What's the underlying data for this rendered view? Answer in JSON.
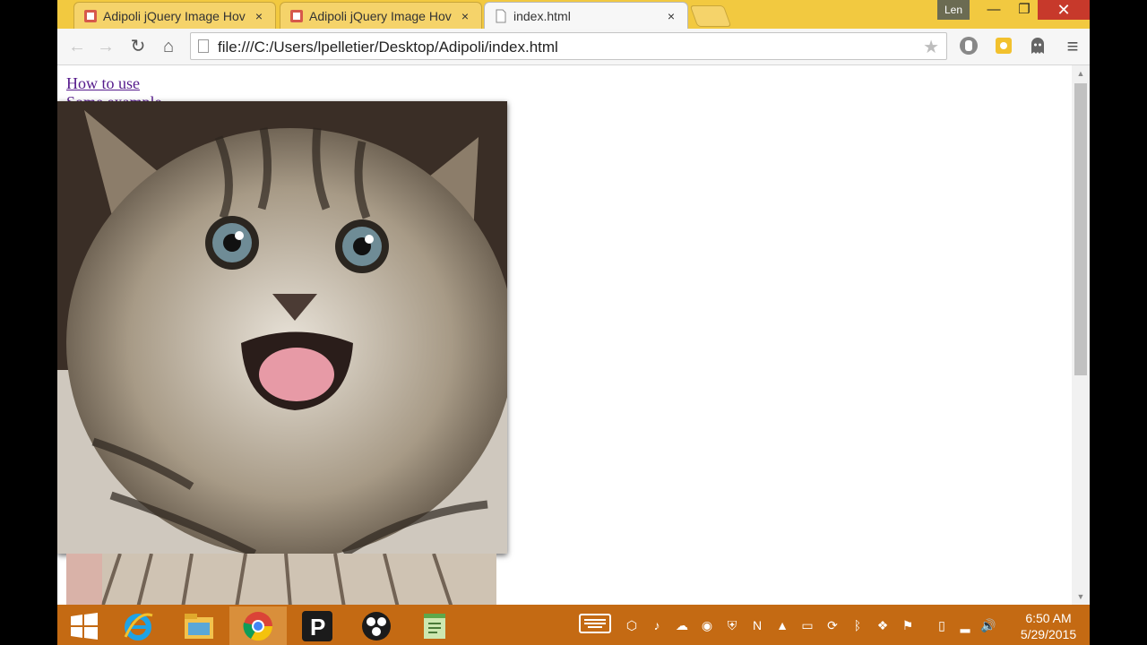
{
  "browser": {
    "tabs": [
      {
        "title": "Adipoli jQuery Image Hov",
        "close": "×",
        "active": false
      },
      {
        "title": "Adipoli jQuery Image Hov",
        "close": "×",
        "active": false
      },
      {
        "title": "index.html",
        "close": "×",
        "active": true
      }
    ],
    "user_name": "Len",
    "window_controls": {
      "minimize": "—",
      "restore": "❐",
      "close": "✕"
    },
    "toolbar": {
      "back": "←",
      "forward": "→",
      "reload": "↻",
      "home": "⌂",
      "star": "★",
      "menu": "≡"
    },
    "url": "file:///C:/Users/lpelletier/Desktop/Adipoli/index.html",
    "extensions": [
      "hand-extension-icon",
      "puzzle-extension-icon",
      "ghostery-icon"
    ]
  },
  "page": {
    "links": [
      "How to use",
      "Some example"
    ],
    "image_alt": "kitten"
  },
  "taskbar": {
    "apps": [
      "start-icon",
      "internet-explorer-icon",
      "file-explorer-icon",
      "chrome-icon",
      "p-app-icon",
      "obs-icon",
      "notepad-icon"
    ],
    "tray": [
      "keyboard-icon",
      "action-icon",
      "bell-icon",
      "cloud-icon",
      "chrome-tray-icon",
      "shield-icon",
      "onenote-icon",
      "drive-icon",
      "printer-icon",
      "sync-icon",
      "bluetooth-icon",
      "dropbox-icon",
      "flag-icon",
      "battery-icon",
      "signal-icon",
      "volume-icon"
    ],
    "time": "6:50 AM",
    "date": "5/29/2015"
  },
  "colors": {
    "tabstrip": "#f2c940",
    "taskbar": "#c46a13",
    "link": "#551a8b"
  }
}
